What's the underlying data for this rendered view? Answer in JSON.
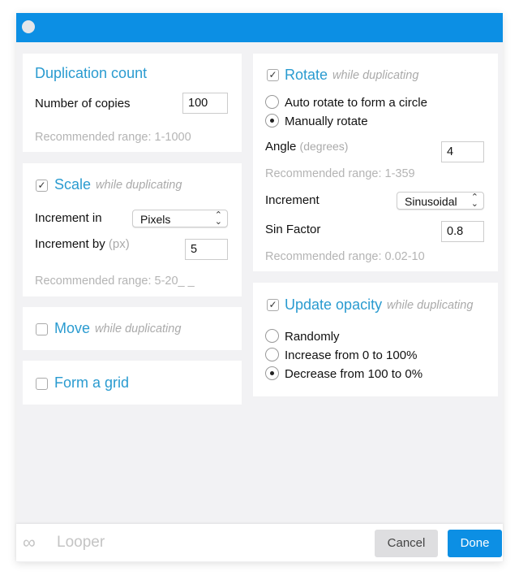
{
  "colors": {
    "accent": "#0c8fe4",
    "title": "#2a9bd0"
  },
  "duplication": {
    "title": "Duplication count",
    "copies_label": "Number of copies",
    "copies_value": "100",
    "hint": "Recommended range: 1-1000"
  },
  "scale": {
    "checked": true,
    "title": "Scale",
    "suffix": "while duplicating",
    "increment_in_label": "Increment in",
    "increment_in_value": "Pixels",
    "increment_by_label": "Increment by",
    "increment_by_unit": "(px)",
    "increment_by_value": "5",
    "hint": "Recommended range: 5-20_ _"
  },
  "move": {
    "checked": false,
    "title": "Move",
    "suffix": "while duplicating"
  },
  "grid": {
    "checked": false,
    "title": "Form a grid"
  },
  "rotate": {
    "checked": true,
    "title": "Rotate",
    "suffix": "while duplicating",
    "options": [
      "Auto rotate to form a circle",
      "Manually rotate"
    ],
    "selected": 1,
    "angle_label": "Angle",
    "angle_unit": "(degrees)",
    "angle_value": "4",
    "angle_hint": "Recommended range: 1-359",
    "increment_label": "Increment",
    "increment_value": "Sinusoidal",
    "sin_label": "Sin Factor",
    "sin_value": "0.8",
    "sin_hint": "Recommended range: 0.02-10"
  },
  "opacity": {
    "checked": true,
    "title": "Update opacity",
    "suffix": "while duplicating",
    "options": [
      "Randomly",
      "Increase from 0 to 100%",
      "Decrease from 100 to 0%"
    ],
    "selected": 2
  },
  "footer": {
    "brand": "Looper",
    "cancel": "Cancel",
    "done": "Done"
  }
}
